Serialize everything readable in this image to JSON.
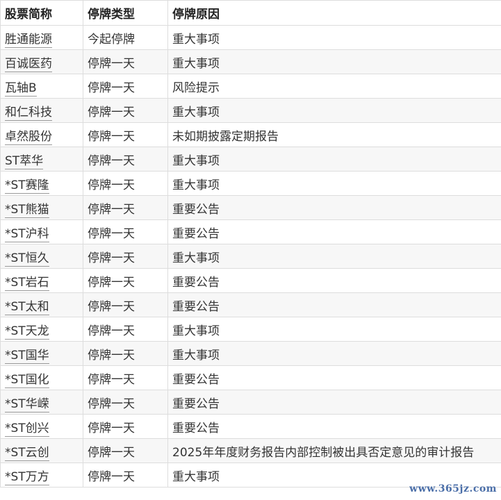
{
  "table": {
    "headers": [
      "股票简称",
      "停牌类型",
      "停牌原因"
    ],
    "rows": [
      {
        "name": "胜通能源",
        "type": "今起停牌",
        "reason": "重大事项"
      },
      {
        "name": "百诚医药",
        "type": "停牌一天",
        "reason": "重大事项"
      },
      {
        "name": "瓦轴B",
        "type": "停牌一天",
        "reason": "风险提示"
      },
      {
        "name": "和仁科技",
        "type": "停牌一天",
        "reason": "重大事项"
      },
      {
        "name": "卓然股份",
        "type": "停牌一天",
        "reason": "未如期披露定期报告"
      },
      {
        "name": "ST萃华",
        "type": "停牌一天",
        "reason": "重大事项"
      },
      {
        "name": "*ST赛隆",
        "type": "停牌一天",
        "reason": "重大事项"
      },
      {
        "name": "*ST熊猫",
        "type": "停牌一天",
        "reason": "重要公告"
      },
      {
        "name": "*ST沪科",
        "type": "停牌一天",
        "reason": "重要公告"
      },
      {
        "name": "*ST恒久",
        "type": "停牌一天",
        "reason": "重大事项"
      },
      {
        "name": "*ST岩石",
        "type": "停牌一天",
        "reason": "重要公告"
      },
      {
        "name": "*ST太和",
        "type": "停牌一天",
        "reason": "重要公告"
      },
      {
        "name": "*ST天龙",
        "type": "停牌一天",
        "reason": "重大事项"
      },
      {
        "name": "*ST国华",
        "type": "停牌一天",
        "reason": "重大事项"
      },
      {
        "name": "*ST国化",
        "type": "停牌一天",
        "reason": "重要公告"
      },
      {
        "name": "*ST华嵘",
        "type": "停牌一天",
        "reason": "重要公告"
      },
      {
        "name": "*ST创兴",
        "type": "停牌一天",
        "reason": "重要公告"
      },
      {
        "name": "*ST云创",
        "type": "停牌一天",
        "reason": "2025年年度财务报告内部控制被出具否定意见的审计报告"
      },
      {
        "name": "*ST万方",
        "type": "停牌一天",
        "reason": "重大事项"
      }
    ]
  },
  "watermark": "www.365jz.com",
  "colors": {
    "border": "#dddddd",
    "stripe": "#f7f7f7",
    "text": "#333333",
    "watermark": "#4a6ea8"
  }
}
